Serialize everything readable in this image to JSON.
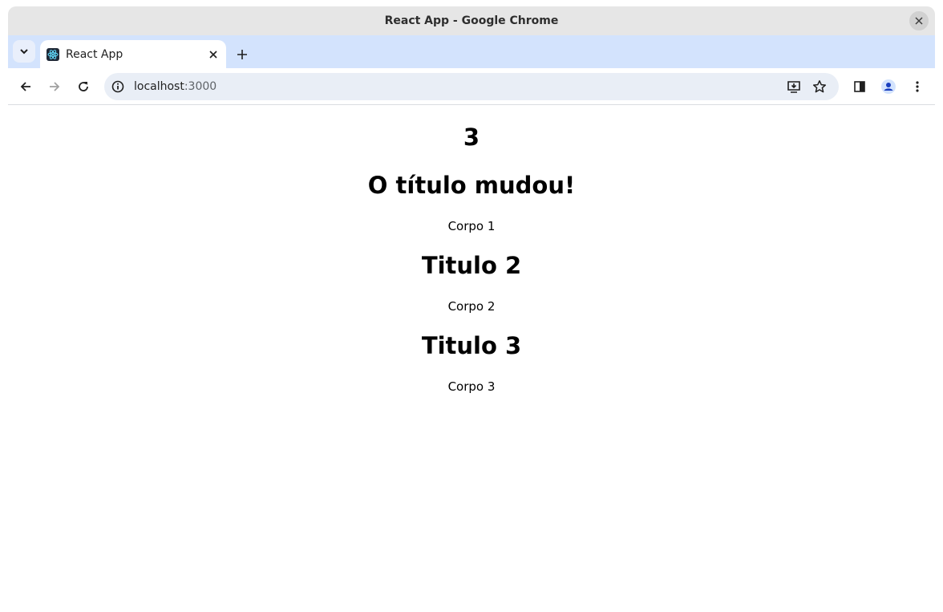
{
  "window": {
    "title": "React App - Google Chrome"
  },
  "tabs": [
    {
      "title": "React App"
    }
  ],
  "omnibox": {
    "host": "localhost",
    "port": ":3000"
  },
  "content": {
    "counter": "3",
    "sections": [
      {
        "title": "O título mudou!",
        "body": "Corpo 1"
      },
      {
        "title": "Titulo 2",
        "body": "Corpo 2"
      },
      {
        "title": "Titulo 3",
        "body": "Corpo 3"
      }
    ]
  },
  "icons": {
    "accent": "#1a73e8",
    "tabstrip_color": "#d3e3fd",
    "omnibox_color": "#e9eef6"
  }
}
